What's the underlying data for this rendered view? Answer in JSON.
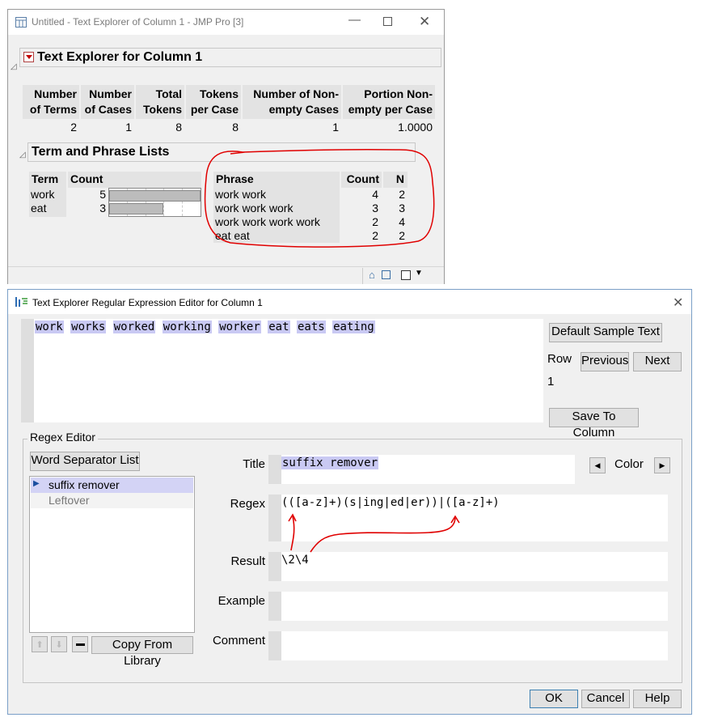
{
  "win1": {
    "title": "Untitled - Text Explorer of Column 1 - JMP Pro [3]",
    "report_title": "Text Explorer for Column 1",
    "summary": {
      "headers": [
        [
          "Number",
          "of Terms"
        ],
        [
          "Number",
          "of Cases"
        ],
        [
          "Total",
          "Tokens"
        ],
        [
          "Tokens",
          "per Case"
        ],
        [
          "Number of Non-",
          "empty Cases"
        ],
        [
          "Portion Non-",
          "empty per Case"
        ]
      ],
      "values": [
        "2",
        "1",
        "8",
        "8",
        "1",
        "1.0000"
      ]
    },
    "lists_title": "Term and Phrase Lists",
    "terms": {
      "headers": [
        "Term",
        "Count"
      ],
      "rows": [
        {
          "term": "work",
          "count": "5",
          "fraction": 1.0
        },
        {
          "term": "eat",
          "count": "3",
          "fraction": 0.6
        }
      ]
    },
    "phrases": {
      "headers": [
        "Phrase",
        "Count",
        "N"
      ],
      "rows": [
        {
          "phrase": "work work",
          "count": "4",
          "n": "2"
        },
        {
          "phrase": "work work work",
          "count": "3",
          "n": "3"
        },
        {
          "phrase": "work work work work",
          "count": "2",
          "n": "4"
        },
        {
          "phrase": "eat eat",
          "count": "2",
          "n": "2"
        }
      ]
    }
  },
  "win2": {
    "title": "Text Explorer Regular Expression Editor for Column 1",
    "sample_words": [
      "work",
      "works",
      "worked",
      "working",
      "worker",
      "eat",
      "eats",
      "eating"
    ],
    "default_sample_text_button": "Default Sample Text",
    "row_label": "Row",
    "row_value": "1",
    "previous_button": "Previous",
    "next_button": "Next",
    "save_to_column_button": "Save To Column",
    "regex_editor_title": "Regex Editor",
    "word_separator_button": "Word Separator List",
    "list_items": [
      "suffix remover",
      "Leftover"
    ],
    "copy_from_library_button": "Copy From Library",
    "fields": {
      "title_label": "Title",
      "title_value": "suffix remover",
      "color_label": "Color",
      "regex_label": "Regex",
      "regex_value": "(([a-z]+)(s|ing|ed|er))|([a-z]+)",
      "result_label": "Result",
      "result_value": "\\2\\4",
      "example_label": "Example",
      "example_value": "",
      "comment_label": "Comment",
      "comment_value": ""
    },
    "ok_button": "OK",
    "cancel_button": "Cancel",
    "help_button": "Help"
  },
  "colors": {
    "annotation_red": "#e00000",
    "selection": "#c9c9f3",
    "gray_header": "#e3e3e3"
  }
}
